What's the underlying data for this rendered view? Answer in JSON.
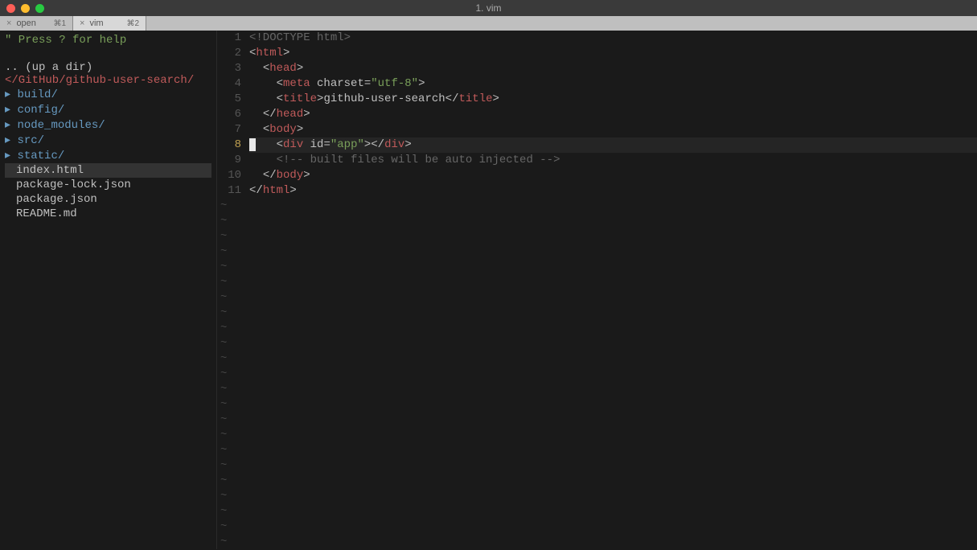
{
  "window": {
    "title": "1. vim"
  },
  "tabs": [
    {
      "label": "open",
      "badge": "⌘1",
      "active": false
    },
    {
      "label": "vim",
      "badge": "⌘2",
      "active": true
    }
  ],
  "sidebar": {
    "help": "\" Press ? for help",
    "updir": ".. (up a dir)",
    "path": "</GitHub/github-user-search/",
    "items": [
      {
        "name": "build/",
        "type": "dir"
      },
      {
        "name": "config/",
        "type": "dir"
      },
      {
        "name": "node_modules/",
        "type": "dir"
      },
      {
        "name": "src/",
        "type": "dir"
      },
      {
        "name": "static/",
        "type": "dir"
      },
      {
        "name": "index.html",
        "type": "file",
        "selected": true
      },
      {
        "name": "package-lock.json",
        "type": "file"
      },
      {
        "name": "package.json",
        "type": "file"
      },
      {
        "name": "README.md",
        "type": "file"
      }
    ]
  },
  "editor": {
    "current_line": 8,
    "total_lines": 11,
    "line_numbers": [
      "1",
      "2",
      "3",
      "4",
      "5",
      "6",
      "7",
      "8",
      "9",
      "10",
      "11"
    ],
    "lines": [
      {
        "indent": 0,
        "tokens": [
          {
            "t": "<!DOCTYPE html>",
            "c": "doctype"
          }
        ]
      },
      {
        "indent": 0,
        "tokens": [
          {
            "t": "<",
            "c": "bracket"
          },
          {
            "t": "html",
            "c": "tag"
          },
          {
            "t": ">",
            "c": "bracket"
          }
        ]
      },
      {
        "indent": 1,
        "tokens": [
          {
            "t": "<",
            "c": "bracket"
          },
          {
            "t": "head",
            "c": "tag"
          },
          {
            "t": ">",
            "c": "bracket"
          }
        ]
      },
      {
        "indent": 2,
        "tokens": [
          {
            "t": "<",
            "c": "bracket"
          },
          {
            "t": "meta",
            "c": "tag"
          },
          {
            "t": " ",
            "c": "text"
          },
          {
            "t": "charset",
            "c": "text"
          },
          {
            "t": "=",
            "c": "text"
          },
          {
            "t": "\"utf-8\"",
            "c": "string"
          },
          {
            "t": ">",
            "c": "bracket"
          }
        ]
      },
      {
        "indent": 2,
        "tokens": [
          {
            "t": "<",
            "c": "bracket"
          },
          {
            "t": "title",
            "c": "tag"
          },
          {
            "t": ">",
            "c": "bracket"
          },
          {
            "t": "github-user-search",
            "c": "text"
          },
          {
            "t": "</",
            "c": "bracket"
          },
          {
            "t": "title",
            "c": "tag"
          },
          {
            "t": ">",
            "c": "bracket"
          }
        ]
      },
      {
        "indent": 1,
        "tokens": [
          {
            "t": "</",
            "c": "bracket"
          },
          {
            "t": "head",
            "c": "tag"
          },
          {
            "t": ">",
            "c": "bracket"
          }
        ]
      },
      {
        "indent": 1,
        "tokens": [
          {
            "t": "<",
            "c": "bracket"
          },
          {
            "t": "body",
            "c": "tag"
          },
          {
            "t": ">",
            "c": "bracket"
          }
        ]
      },
      {
        "indent": 2,
        "current": true,
        "tokens": [
          {
            "t": "<",
            "c": "bracket"
          },
          {
            "t": "div",
            "c": "tag"
          },
          {
            "t": " ",
            "c": "text"
          },
          {
            "t": "id",
            "c": "text"
          },
          {
            "t": "=",
            "c": "text"
          },
          {
            "t": "\"app\"",
            "c": "string"
          },
          {
            "t": ">",
            "c": "bracket"
          },
          {
            "t": "</",
            "c": "bracket"
          },
          {
            "t": "div",
            "c": "tag"
          },
          {
            "t": ">",
            "c": "bracket"
          }
        ]
      },
      {
        "indent": 2,
        "tokens": [
          {
            "t": "<!-- built files will be auto injected -->",
            "c": "comment"
          }
        ]
      },
      {
        "indent": 1,
        "tokens": [
          {
            "t": "</",
            "c": "bracket"
          },
          {
            "t": "body",
            "c": "tag"
          },
          {
            "t": ">",
            "c": "bracket"
          }
        ]
      },
      {
        "indent": 0,
        "tokens": [
          {
            "t": "</",
            "c": "bracket"
          },
          {
            "t": "html",
            "c": "tag"
          },
          {
            "t": ">",
            "c": "bracket"
          }
        ]
      }
    ]
  }
}
